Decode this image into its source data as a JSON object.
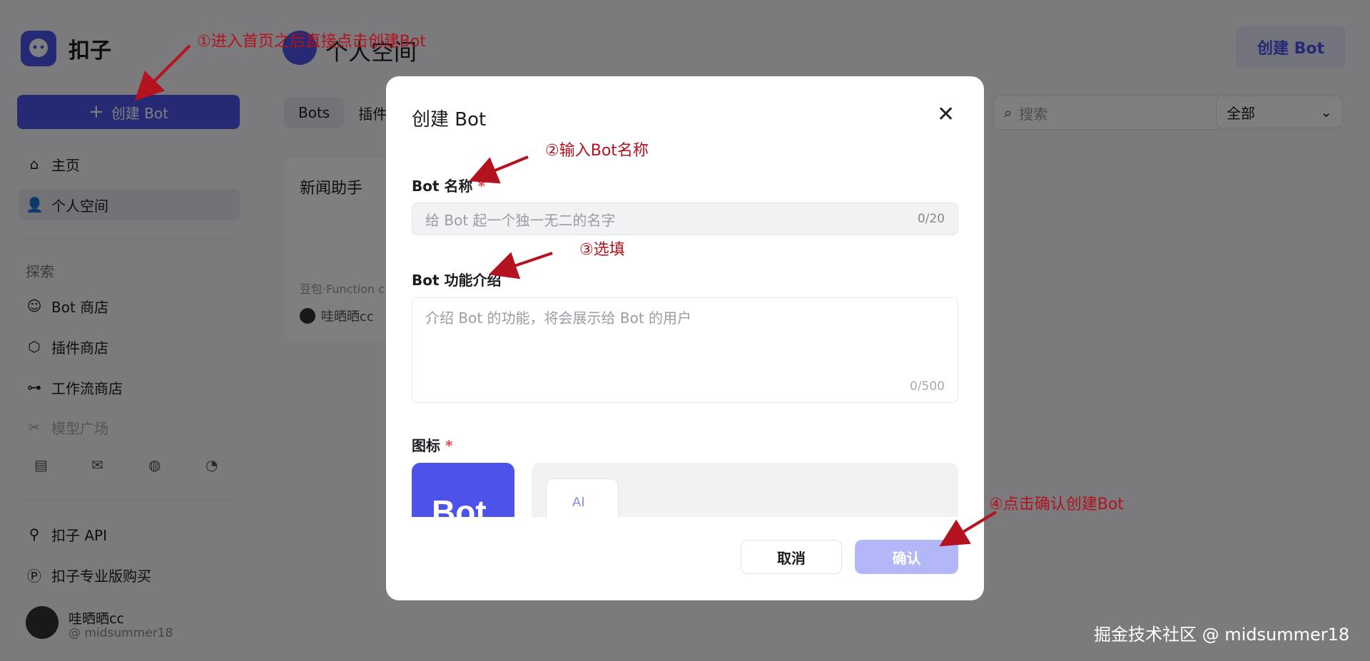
{
  "sidebar": {
    "logo_text": "扣子",
    "create_button": {
      "plus": "+",
      "label": "创建 Bot"
    },
    "nav_top": [
      {
        "icon": "home-icon",
        "label": "主页",
        "active": false
      },
      {
        "icon": "user-icon",
        "label": "个人空间",
        "active": true
      }
    ],
    "explore_label": "探索",
    "nav_explore": [
      {
        "icon": "bot-store-icon",
        "label": "Bot 商店"
      },
      {
        "icon": "plugin-store-icon",
        "label": "插件商店"
      },
      {
        "icon": "workflow-store-icon",
        "label": "工作流商店"
      },
      {
        "icon": "model-square-icon",
        "label": "模型广场"
      }
    ],
    "nav_bottom": [
      {
        "icon": "api-icon",
        "label": "扣子 API"
      },
      {
        "icon": "pay-icon",
        "label": "扣子专业版购买"
      }
    ],
    "user": {
      "name": "哇晒晒cc",
      "handle": "@ midsummer18"
    }
  },
  "main": {
    "space_title": "个人空间",
    "top_create_label": "创建 Bot",
    "tabs": [
      "Bots",
      "插件"
    ],
    "search_placeholder": "搜索",
    "filter_value": "全部",
    "card": {
      "title": "新闻助手",
      "desc": "豆包·Function c",
      "user": "哇晒晒cc"
    }
  },
  "modal": {
    "title": "创建 Bot",
    "close_glyph": "✕",
    "name_label": "Bot 名称",
    "required_mark": "*",
    "name_placeholder": "给 Bot 起一个独一无二的名字",
    "name_count": "0/20",
    "desc_label": "Bot 功能介绍",
    "desc_placeholder": "介绍 Bot 的功能，将会展示给 Bot 的用户",
    "desc_count": "0/500",
    "icon_label": "图标",
    "bot_icon_text": "Bot",
    "gen_icon_text": "AI",
    "cancel_label": "取消",
    "confirm_label": "确认"
  },
  "annotations": {
    "a1": "①进入首页之后直接点击创建Bot",
    "a2": "②输入Bot名称",
    "a3": "③选填",
    "a4": "④点击确认创建Bot",
    "color": "#b3121f"
  },
  "watermark": "掘金技术社区 @ midsummer18"
}
